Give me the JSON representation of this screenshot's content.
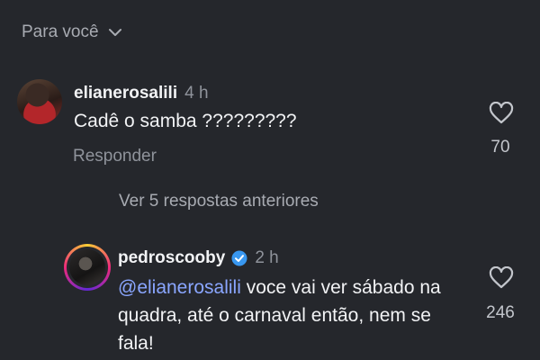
{
  "section": {
    "title": "Para você"
  },
  "comments": [
    {
      "username": "elianerosalili",
      "time": "4 h",
      "text": "Cadê o samba ?????????",
      "reply_label": "Responder",
      "likes": "70"
    },
    {
      "username": "pedroscooby",
      "verified": true,
      "time": "2 h",
      "mention": "@elianerosalili",
      "text": " voce vai ver sábado na quadra, até o carnaval então, nem se fala!",
      "likes": "246"
    }
  ],
  "view_previous": "Ver 5 respostas anteriores",
  "colors": {
    "background": "#25272c",
    "mention": "#8aa6ff",
    "verified": "#3897f0"
  },
  "icons": [
    "chevron-down-icon",
    "heart-icon",
    "verified-badge-icon"
  ]
}
